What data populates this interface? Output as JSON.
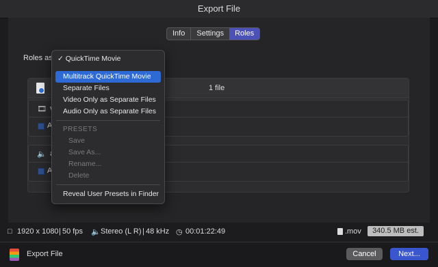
{
  "window": {
    "title": "Export File"
  },
  "tabs": [
    {
      "label": "Info"
    },
    {
      "label": "Settings"
    },
    {
      "label": "Roles",
      "active": true
    }
  ],
  "roles": {
    "label": "Roles as",
    "file_count": "1 file",
    "video_role_initial": "v",
    "audio_role_initial": "a",
    "video_row_initial": "A",
    "audio_row_initial": "A"
  },
  "dropdown": {
    "items": [
      {
        "label": "QuickTime Movie",
        "checked": true
      },
      {
        "label": "Multitrack QuickTime Movie",
        "highlighted": true
      },
      {
        "label": "Separate Files"
      },
      {
        "label": "Video Only as Separate Files"
      },
      {
        "label": "Audio Only as Separate Files"
      }
    ],
    "presets_header": "PRESETS",
    "presets": [
      {
        "label": "Save"
      },
      {
        "label": "Save As..."
      },
      {
        "label": "Rename..."
      },
      {
        "label": "Delete"
      }
    ],
    "reveal": "Reveal User Presets in Finder"
  },
  "status": {
    "resolution": "1920 x 1080",
    "fps": "50 fps",
    "audio": "Stereo (L R)",
    "sample_rate": "48 kHz",
    "duration": "00:01:22:49",
    "extension": ".mov",
    "size": "340.5 MB est."
  },
  "footer": {
    "title": "Export File",
    "cancel": "Cancel",
    "next": "Next..."
  },
  "colors": {
    "accent": "#3a56cf",
    "highlight": "#2e6ad6",
    "tab_active": "#4b51b7"
  }
}
